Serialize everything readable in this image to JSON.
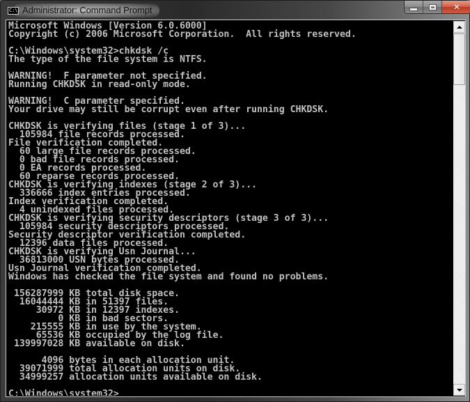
{
  "window": {
    "title": "Administrator: Command Prompt",
    "app_icon": "console-icon",
    "app_icon_text": "C:\\_",
    "caption_buttons": {
      "minimize": "minimize-icon",
      "maximize": "maximize-icon",
      "close": "close-icon",
      "close_glyph": "✕"
    }
  },
  "console": {
    "foreground_color": "#c0c0c0",
    "background_color": "#000000",
    "lines": [
      "Microsoft Windows [Version 6.0.6000]",
      "Copyright (c) 2006 Microsoft Corporation.  All rights reserved.",
      "",
      "C:\\Windows\\system32>chkdsk /c",
      "The type of the file system is NTFS.",
      "",
      "WARNING!  F parameter not specified.",
      "Running CHKDSK in read-only mode.",
      "",
      "WARNING!  C parameter specified.",
      "Your drive may still be corrupt even after running CHKDSK.",
      "",
      "CHKDSK is verifying files (stage 1 of 3)...",
      "  105984 file records processed.",
      "File verification completed.",
      "  60 large file records processed.",
      "  0 bad file records processed.",
      "  0 EA records processed.",
      "  60 reparse records processed.",
      "CHKDSK is verifying indexes (stage 2 of 3)...",
      "  336666 index entries processed.",
      "Index verification completed.",
      "  4 unindexed files processed.",
      "CHKDSK is verifying security descriptors (stage 3 of 3)...",
      "  105984 security descriptors processed.",
      "Security descriptor verification completed.",
      "  12396 data files processed.",
      "CHKDSK is verifying Usn Journal...",
      "  36813000 USN bytes processed.",
      "Usn Journal verification completed.",
      "Windows has checked the file system and found no problems.",
      "",
      " 156287999 KB total disk space.",
      "  16044444 KB in 51397 files.",
      "     30972 KB in 12397 indexes.",
      "         0 KB in bad sectors.",
      "    215555 KB in use by the system.",
      "     65536 KB occupied by the log file.",
      " 139997028 KB available on disk.",
      "",
      "      4096 bytes in each allocation unit.",
      "  39071999 total allocation units on disk.",
      "  34999257 allocation units available on disk.",
      ""
    ],
    "prompt": "C:\\Windows\\system32>",
    "input_value": ""
  },
  "scrollbar": {
    "up_icon": "scroll-up-arrow-icon",
    "down_icon": "scroll-down-arrow-icon",
    "position_fraction": 0.0
  }
}
